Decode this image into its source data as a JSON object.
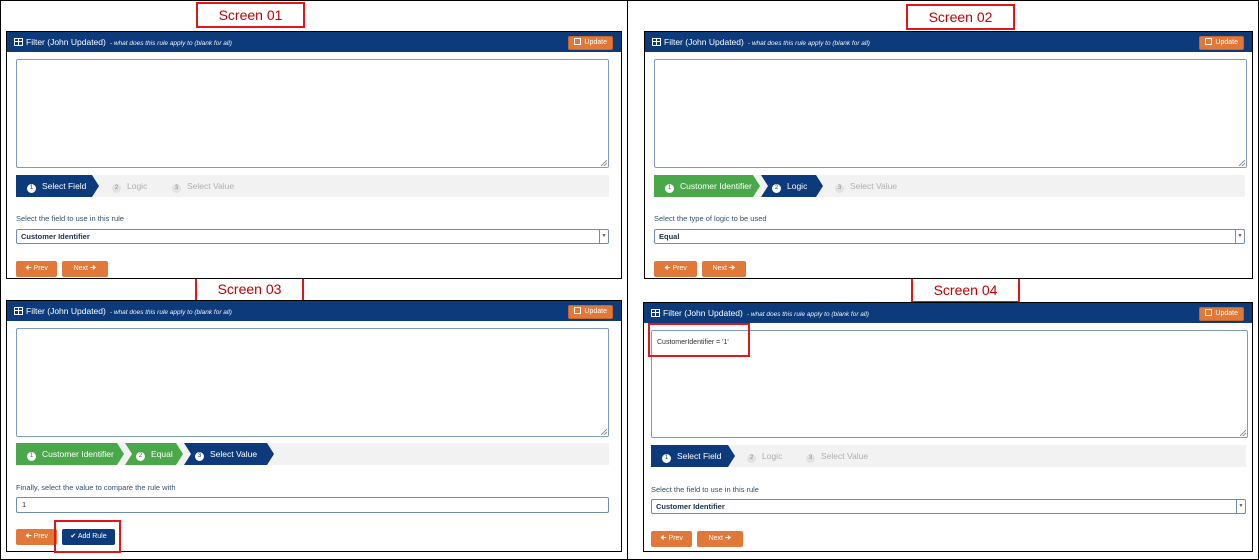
{
  "labels": {
    "s1": "Screen 01",
    "s2": "Screen 02",
    "s3": "Screen 03",
    "s4": "Screen 04"
  },
  "panel": {
    "title": "Filter (John Updated)",
    "hint": "- what does this rule apply to (blank for all)",
    "update_label": "Update",
    "prev_label": "Prev",
    "next_label": "Next",
    "add_rule_label": "Add Rule"
  },
  "screen1": {
    "steps": [
      "Select Field",
      "Logic",
      "Select Value"
    ],
    "step_nums": [
      "1",
      "2",
      "3"
    ],
    "prompt": "Select the field to use in this rule",
    "selected": "Customer Identifier"
  },
  "screen2": {
    "steps": [
      "Customer Identifier",
      "Logic",
      "Select Value"
    ],
    "step_nums": [
      "1",
      "2",
      "3"
    ],
    "prompt": "Select the type of logic to be used",
    "selected": "Equal"
  },
  "screen3": {
    "steps": [
      "Customer Identifier",
      "Equal",
      "Select Value"
    ],
    "step_nums": [
      "1",
      "2",
      "3"
    ],
    "prompt": "Finally, select the value to compare the rule with",
    "value": "1"
  },
  "screen4": {
    "rule_text": "CustomerIdentifier = '1'",
    "steps": [
      "Select Field",
      "Logic",
      "Select Value"
    ],
    "step_nums": [
      "1",
      "2",
      "3"
    ],
    "prompt": "Select the field to use in this rule",
    "selected": "Customer Identifier"
  },
  "colors": {
    "header": "#0c3a7a",
    "accent": "#e0783a",
    "done": "#4aa84a",
    "highlight": "#e0161a"
  }
}
